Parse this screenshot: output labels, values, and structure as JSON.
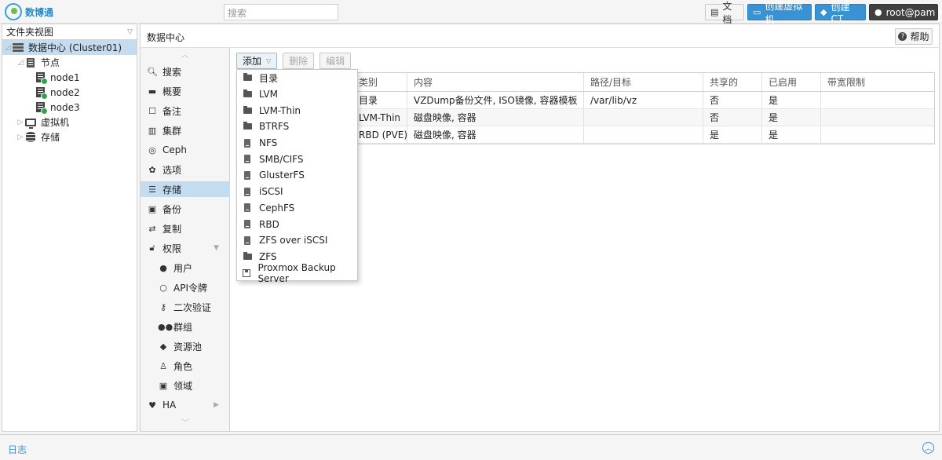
{
  "app": {
    "logo_text": "数博通",
    "search_placeholder": "搜索"
  },
  "topbar": {
    "docs": "文档",
    "create_vm": "创建虚拟机",
    "create_ct": "创建CT",
    "user": "root@pam"
  },
  "left": {
    "view": "文件夹视图",
    "tree": {
      "datacenter": "数据中心 (Cluster01)",
      "nodes": "节点",
      "node_list": [
        "node1",
        "node2",
        "node3"
      ],
      "vms": "虚拟机",
      "storage": "存储"
    }
  },
  "center": {
    "title": "数据中心",
    "help": "帮助"
  },
  "submenu": {
    "items": [
      "搜索",
      "概要",
      "备注",
      "集群",
      "Ceph",
      "选项",
      "存储",
      "备份",
      "复制",
      "权限",
      "用户",
      "API令牌",
      "二次验证",
      "群组",
      "资源池",
      "角色",
      "领域",
      "HA"
    ]
  },
  "toolbar": {
    "add": "添加",
    "remove": "删除",
    "edit": "编辑"
  },
  "grid": {
    "columns": [
      "",
      "类别",
      "内容",
      "路径/目标",
      "共享的",
      "已启用",
      "带宽限制"
    ],
    "rows": [
      {
        "id": "",
        "type": "目录",
        "content": "VZDump备份文件, ISO镜像, 容器模板",
        "path": "/var/lib/vz",
        "shared": "否",
        "enabled": "是",
        "bw": ""
      },
      {
        "id": "",
        "type": "LVM-Thin",
        "content": "磁盘映像, 容器",
        "path": "",
        "shared": "否",
        "enabled": "是",
        "bw": ""
      },
      {
        "id": "",
        "type": "RBD (PVE)",
        "content": "磁盘映像, 容器",
        "path": "",
        "shared": "是",
        "enabled": "是",
        "bw": ""
      }
    ]
  },
  "add_menu": {
    "items": [
      "目录",
      "LVM",
      "LVM-Thin",
      "BTRFS",
      "NFS",
      "SMB/CIFS",
      "GlusterFS",
      "iSCSI",
      "CephFS",
      "RBD",
      "ZFS over iSCSI",
      "ZFS",
      "Proxmox Backup Server"
    ]
  },
  "footer": {
    "label": "日志"
  },
  "colors": {
    "accent": "#3892d4",
    "selection": "#c3dcf0",
    "status_ok": "#2ea44f"
  }
}
